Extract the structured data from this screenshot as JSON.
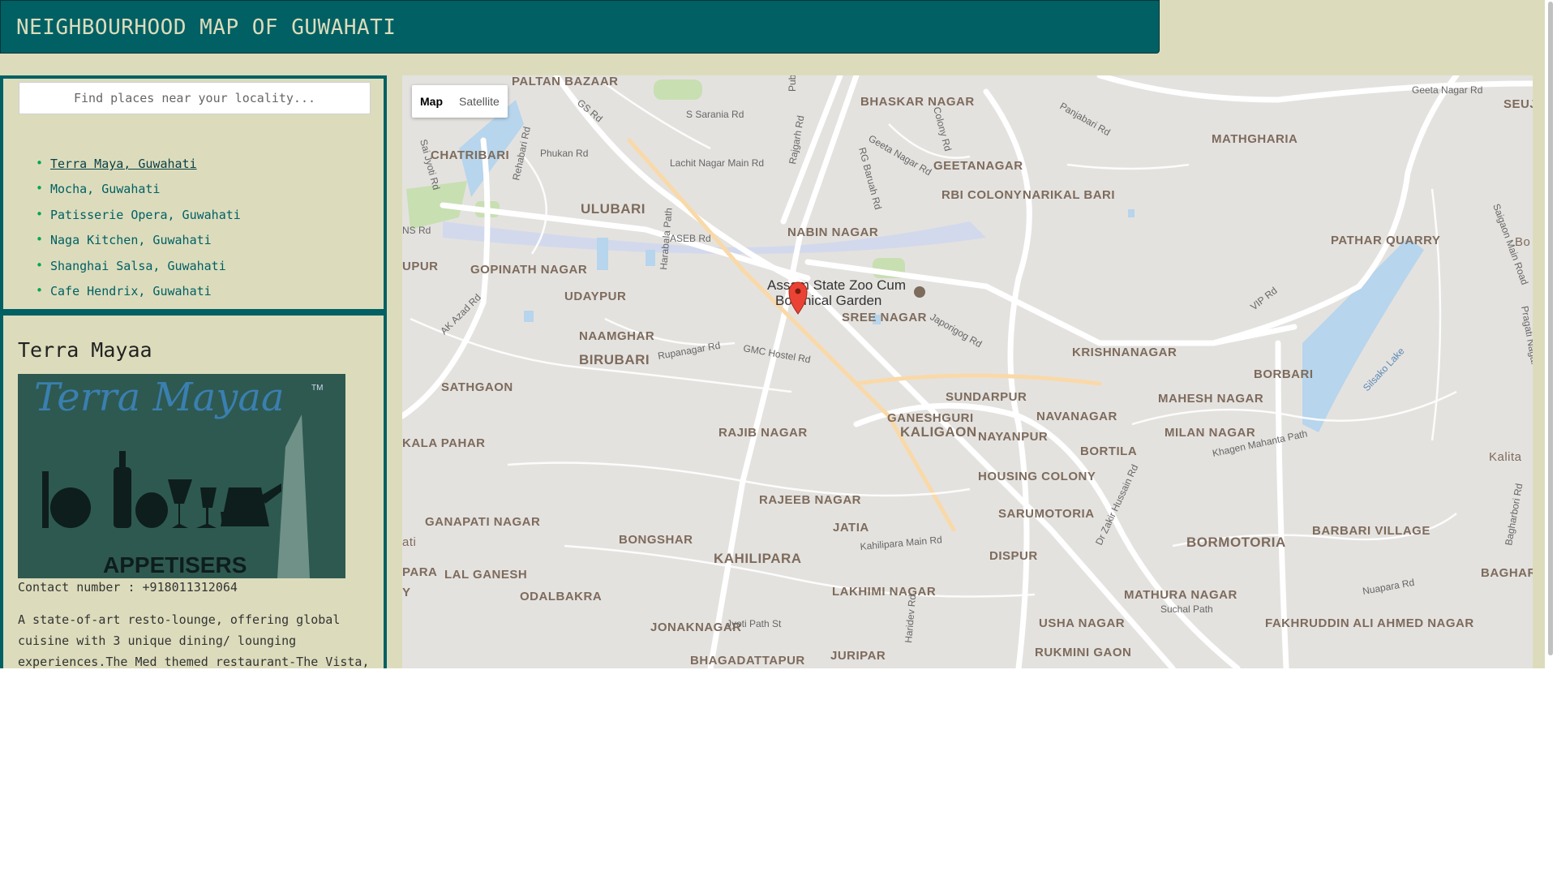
{
  "header": {
    "title": "NEIGHBOURHOOD MAP OF GUWAHATI"
  },
  "search": {
    "placeholder": "Find places near your locality..."
  },
  "places": [
    {
      "label": "Terra Maya, Guwahati",
      "active": true
    },
    {
      "label": "Mocha, Guwahati",
      "active": false
    },
    {
      "label": "Patisserie Opera, Guwahati",
      "active": false
    },
    {
      "label": "Naga Kitchen, Guwahati",
      "active": false
    },
    {
      "label": "Shanghai Salsa, Guwahati",
      "active": false
    },
    {
      "label": "Cafe Hendrix, Guwahati",
      "active": false
    }
  ],
  "info": {
    "title": "Terra Mayaa",
    "image_text": {
      "logo": "Terra Mayaa",
      "trademark": "TM",
      "caption": "APPETISERS"
    },
    "contact": "Contact number : +918011312064",
    "description": "A state-of-art resto-lounge, offering global cuisine with 3 unique dining/ lounging experiences.The Med themed restaurant-The Vista,"
  },
  "map_controls": {
    "map_label": "Map",
    "satellite_label": "Satellite",
    "selected": "Map"
  },
  "marker": {
    "label": "Assam State Zoo Cum Botanical Garden",
    "icon": "map-pin-icon"
  },
  "map_labels": [
    "PALTAN BAZAAR",
    "BHASKAR NAGAR",
    "CHATRIBARI",
    "ULUBARI",
    "NABIN NAGAR",
    "GEETANAGAR",
    "RBI COLONY",
    "NARIKAL BARI",
    "MATHGHARIA",
    "SEUJ",
    "UPUR",
    "GOPINATH NAGAR",
    "UDAYPUR",
    "PATHAR QUARRY",
    "SREE NAGAR",
    "NAAMGHAR",
    "BIRUBARI",
    "KRISHNANAGAR",
    "SATHGAON",
    "SUNDARPUR",
    "BORBARI",
    "MAHESH NAGAR",
    "NAVANAGAR",
    "GANESHGURI",
    "KALIGAON",
    "NAYANPUR",
    "RAJIB NAGAR",
    "KALA PAHAR",
    "MILAN NAGAR",
    "BORTILA",
    "HOUSING COLONY",
    "Kalita",
    "RAJEEB NAGAR",
    "SARUMOTORIA",
    "GANAPATI NAGAR",
    "JATIA",
    "BONGSHAR",
    "KAHILIPARA",
    "DISPUR",
    "BORMOTORIA",
    "BARBARI VILLAGE",
    "PARA",
    "LAL GANESH",
    "ODALBAKRA",
    "LAKHIMI NAGAR",
    "MATHURA NAGAR",
    "BAGHARI",
    "JONAKNAGAR",
    "USHA NAGAR",
    "FAKHRUDDIN ALI AHMED NAGAR",
    "BHAGADATTAPUR",
    "JURIPAR",
    "RUKMINI GAON",
    "ati",
    "Y",
    "Bo"
  ],
  "road_labels": [
    "GS Rd",
    "S Sarania Rd",
    "Lachit Nagar Main Rd",
    "Rajgarh Rd",
    "RG Baruah Rd",
    "Geeta Nagar Rd",
    "Geeta Nagar Rd",
    "Panjabari Rd",
    "Sai Jyoti Rd",
    "Rehabari Rd",
    "Phukan Rd",
    "ASEB Rd",
    "Harabala Path",
    "AK Azad Rd",
    "Rupanagar Rd",
    "GMC Hostel Rd",
    "Japorigog Rd",
    "VIP Rd",
    "Silsako Lake",
    "Khagen Mahanta Path",
    "Dr Zakir Hussain Rd",
    "Kahilipara Main Rd",
    "Jyoti Path St",
    "Haridev Rd",
    "Suchal Path",
    "Nuapara Rd",
    "Saigaon Main Road",
    "Pragati Nagar",
    "Bagharbori Rd",
    "Colony Rd",
    "Pub S",
    "NS Rd"
  ],
  "colors": {
    "header_bg": "#006064",
    "page_bg": "#dcdcbc",
    "link": "#006064",
    "bullet": "#00a651",
    "marker": "#ea4335"
  }
}
